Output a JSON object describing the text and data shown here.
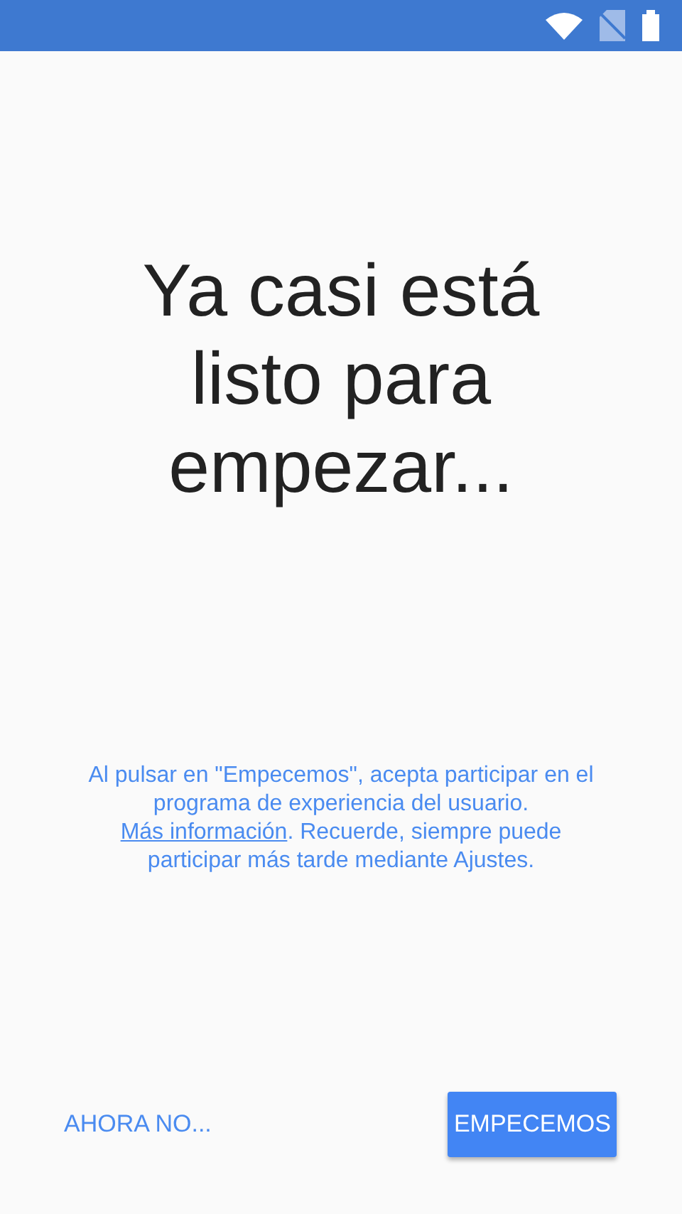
{
  "heading": "Ya casi está listo para empezar...",
  "notice": {
    "before": "Al pulsar en \"Empecemos\", acepta participar en el programa de experiencia del usuario.",
    "link": "Más información",
    "after": ". Recuerde, siempre puede participar más tarde mediante Ajustes."
  },
  "buttons": [
    {
      "label": "AHORA NO...",
      "kind": "text"
    },
    {
      "label": "EMPECEMOS",
      "kind": "raised"
    }
  ]
}
